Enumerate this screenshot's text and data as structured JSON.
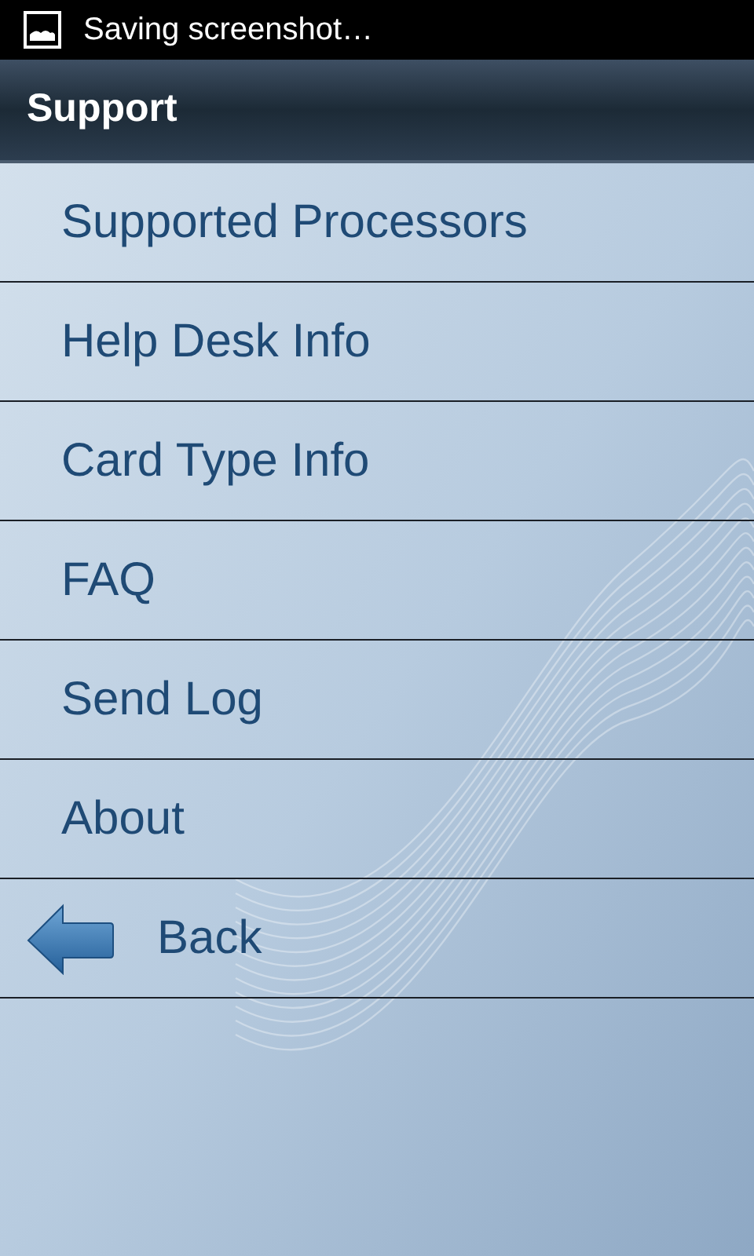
{
  "status_bar": {
    "notification": "Saving screenshot…"
  },
  "title_bar": {
    "title": "Support"
  },
  "menu": [
    {
      "kind": "link",
      "label": "Supported Processors"
    },
    {
      "kind": "link",
      "label": "Help Desk Info"
    },
    {
      "kind": "link",
      "label": "Card Type Info"
    },
    {
      "kind": "link",
      "label": "FAQ"
    },
    {
      "kind": "link",
      "label": "Send Log"
    },
    {
      "kind": "link",
      "label": "About"
    },
    {
      "kind": "back",
      "label": "Back"
    }
  ]
}
